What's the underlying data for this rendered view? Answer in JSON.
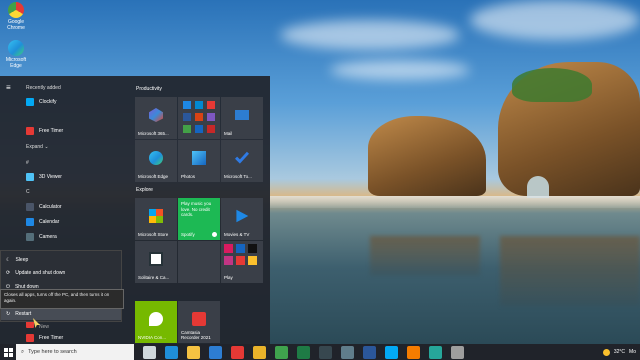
{
  "desktop": {
    "icons": [
      {
        "label": "Google Chrome",
        "color": "#e9b32a"
      },
      {
        "label": "Microsoft Edge",
        "color": "#1f8fd9"
      }
    ]
  },
  "start_menu": {
    "sections": {
      "recently_added": "Recently added",
      "hash": "#",
      "expand": "Expand",
      "c": "C"
    },
    "recent_apps": [
      {
        "label": "Clockify",
        "icon": "clockify-icon",
        "color": "#03a9f4"
      },
      {
        "label": "Free Timer",
        "icon": "timer-icon",
        "color": "#e53935"
      }
    ],
    "hash_apps": [
      {
        "label": "3D Viewer",
        "icon": "cube-icon",
        "color": "#4fc3f7"
      }
    ],
    "c_apps": [
      {
        "label": "Calculator",
        "icon": "calculator-icon",
        "color": "#4a5568"
      },
      {
        "label": "Calendar",
        "icon": "calendar-icon",
        "color": "#1e88e5"
      },
      {
        "label": "Camera",
        "icon": "camera-icon",
        "color": "#546e7a"
      }
    ],
    "bottom_apps": [
      {
        "label": "Free Timer",
        "sub": "New"
      },
      {
        "label": "Free Timer"
      }
    ],
    "power_menu": {
      "sleep": "Sleep",
      "update_shutdown": "Update and shut down",
      "shutdown": "Shut down",
      "restart": "Restart"
    },
    "tooltip": "Closes all apps, turns off the PC, and then turns it on again.",
    "groups": {
      "productivity": "Productivity",
      "explore": "Explore"
    },
    "tiles": {
      "m365": "Microsoft 365...",
      "mail": "Mail",
      "edge": "Microsoft Edge",
      "photos": "Photos",
      "todo": "Microsoft To...",
      "store": "Microsoft Store",
      "spotify": "Spotify",
      "spotify_text": "Play music you love. No credit cards.",
      "movies": "Movies & TV",
      "solitaire": "Solitaire & Ca...",
      "play": "Play",
      "nvidia": "NVIDIA Con...",
      "camtasia": "Camtasia Recorder 2021"
    }
  },
  "taskbar": {
    "search_placeholder": "Type here to search",
    "weather": "32°C",
    "weather_extra": "Mo",
    "pinned": [
      {
        "icon": "task-view-icon",
        "color": "#cfd8dc"
      },
      {
        "icon": "edge-icon",
        "color": "#1f8fd9"
      },
      {
        "icon": "file-explorer-icon",
        "color": "#f5c242"
      },
      {
        "icon": "mail-icon",
        "color": "#2d7dd2"
      },
      {
        "icon": "number-5-icon",
        "color": "#e53935"
      },
      {
        "icon": "chrome-icon",
        "color": "#e9b32a"
      },
      {
        "icon": "camtasia-icon",
        "color": "#3fa34d"
      },
      {
        "icon": "excel-icon",
        "color": "#1e7b45"
      },
      {
        "icon": "terminal-icon",
        "color": "#37474f"
      },
      {
        "icon": "calculator-icon",
        "color": "#607d8b"
      },
      {
        "icon": "word-icon",
        "color": "#2b579a"
      },
      {
        "icon": "clockify-icon",
        "color": "#03a9f4"
      },
      {
        "icon": "vlc-icon",
        "color": "#f57c00"
      },
      {
        "icon": "notes-icon",
        "color": "#26a69a"
      },
      {
        "icon": "settings-icon",
        "color": "#9e9e9e"
      }
    ]
  }
}
